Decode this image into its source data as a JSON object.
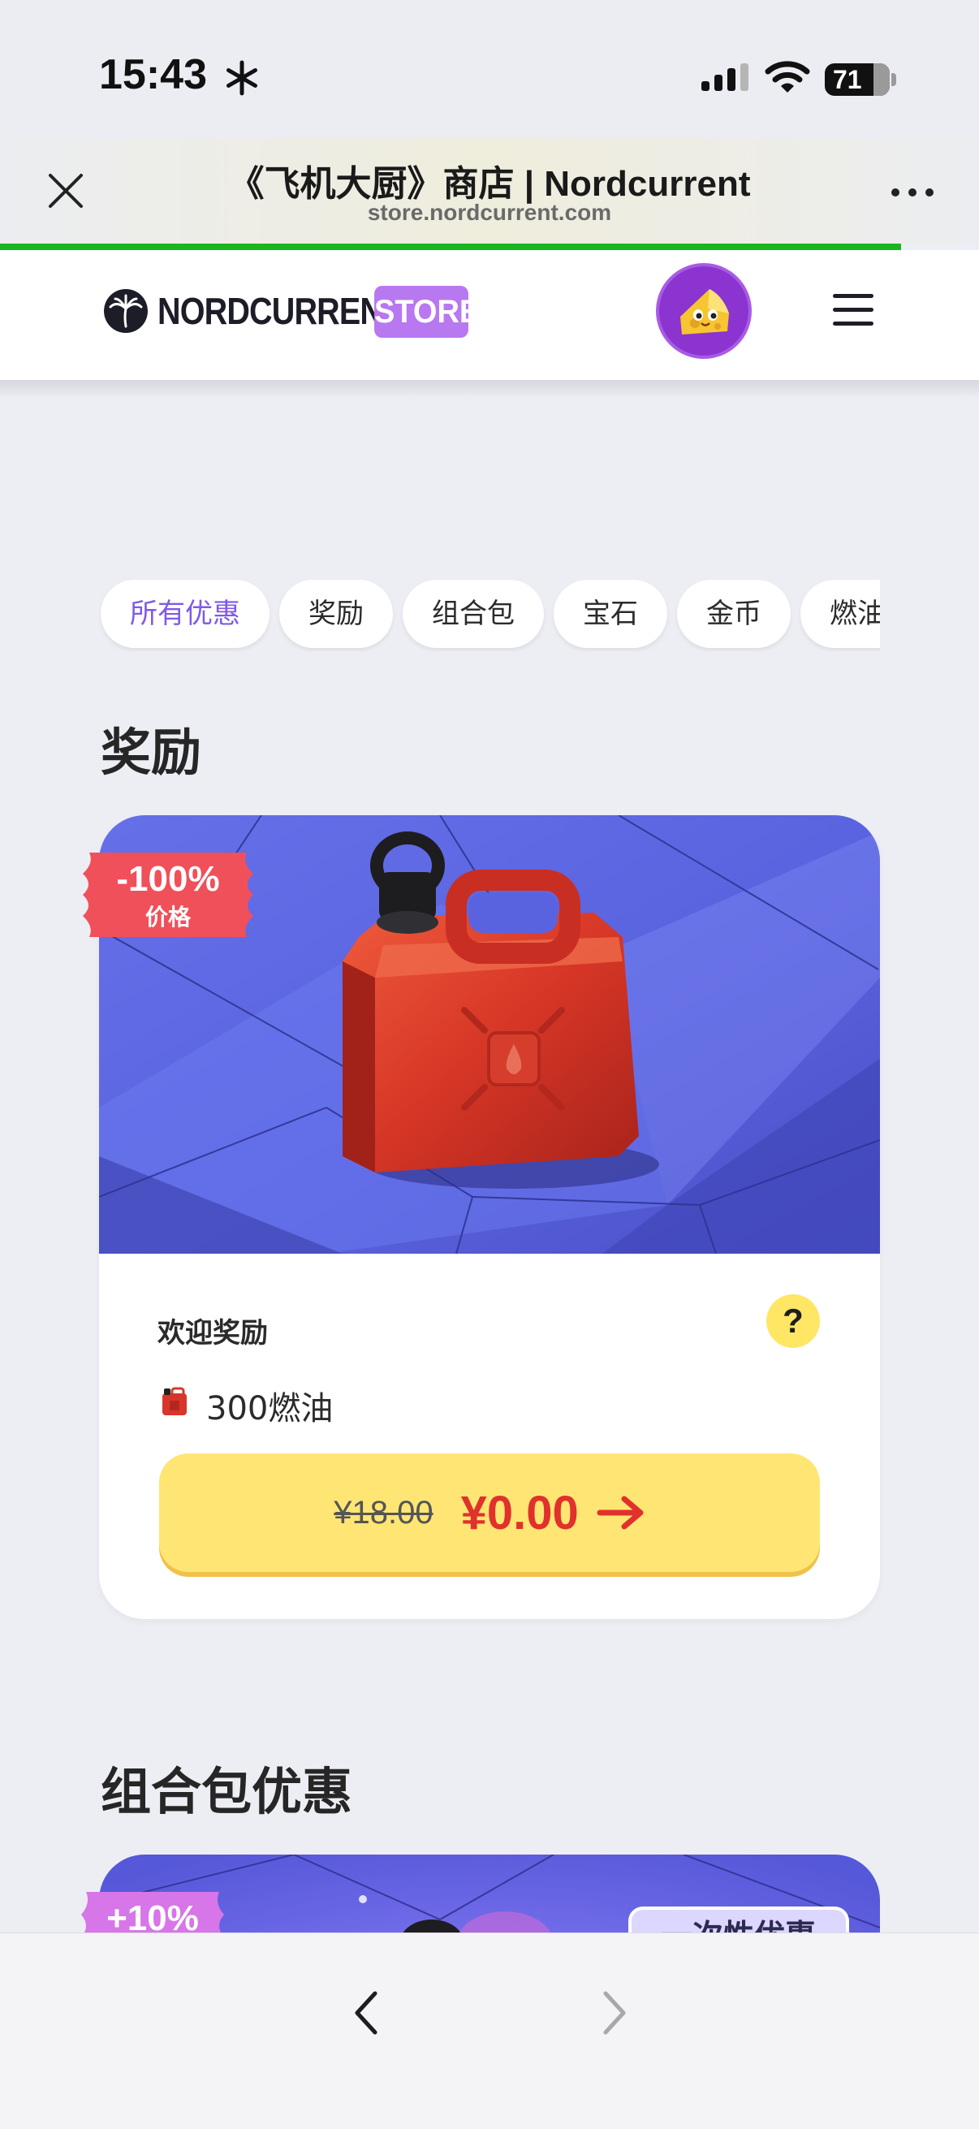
{
  "status_bar": {
    "time": "15:43",
    "battery": "71",
    "icons": [
      "snowflake-icon",
      "cellular-signal-icon",
      "wifi-icon",
      "battery-icon"
    ]
  },
  "browser": {
    "title": "《飞机大厨》商店 | Nordcurrent",
    "url": "store.nordcurrent.com",
    "load_progress": 0.92,
    "progress_color": "#1bb51f",
    "icons": [
      "close-icon",
      "more-icon",
      "back-icon",
      "forward-icon"
    ]
  },
  "site_nav": {
    "brand": "NORDCURRENT",
    "badge": "STORE",
    "badge_color": "#b878f0",
    "icons": [
      "palm-logo-icon",
      "cheese-avatar",
      "menu-icon"
    ]
  },
  "filters": {
    "items": [
      {
        "label": "所有优惠",
        "active": true
      },
      {
        "label": "奖励",
        "active": false
      },
      {
        "label": "组合包",
        "active": false
      },
      {
        "label": "宝石",
        "active": false
      },
      {
        "label": "金币",
        "active": false
      },
      {
        "label": "燃油",
        "active": false
      }
    ],
    "active_color": "#7f59e8"
  },
  "sections": {
    "rewards_title": "奖励",
    "bundles_title": "组合包优惠"
  },
  "reward_offer": {
    "discount": "-100%",
    "discount_label": "价格",
    "name": "欢迎奖励",
    "help": "?",
    "item": "300燃油",
    "old_price": "¥18.00",
    "new_price": "¥0.00",
    "icons": [
      "fuel-canister-image",
      "fuel-icon",
      "help-icon",
      "arrow-right-icon"
    ],
    "colors": {
      "button": "#ffe674",
      "price": "#e0312c",
      "tag": "#f0505a"
    }
  },
  "bundle_offer": {
    "discount": "+10%",
    "badge": "一次性优惠",
    "tag_color": "#d776e8"
  }
}
